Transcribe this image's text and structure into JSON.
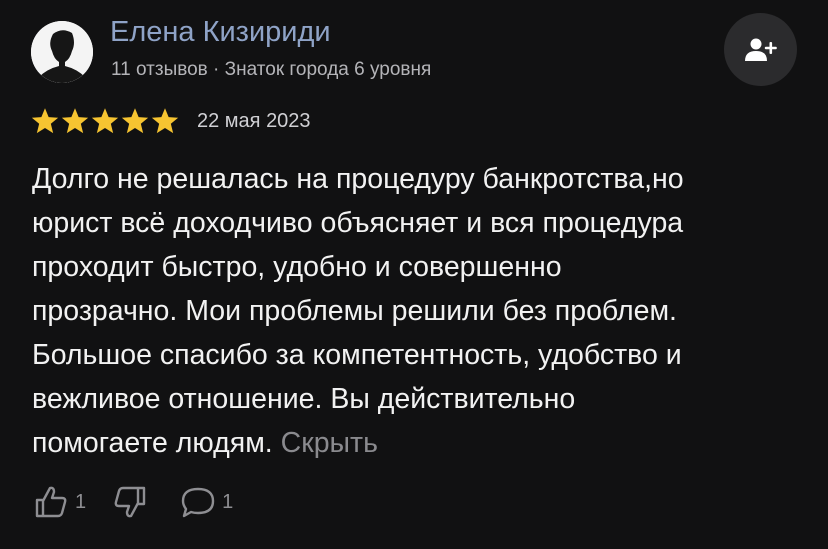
{
  "author": {
    "name": "Елена Кизириди",
    "meta": "11 отзывов · Знаток города 6 уровня"
  },
  "review": {
    "rating": 5,
    "rating_max": 5,
    "date": "22 мая 2023",
    "text_lines": [
      "Долго не решалась на процедуру банкротства,но",
      "юрист всё доходчиво объясняет и вся процедура",
      "проходит быстро, удобно и совершенно",
      "прозрачно. Мои проблемы решили без проблем.",
      "Большое спасибо за компетентность, удобство и",
      "вежливое отношение. Вы действительно",
      "помогаете людям."
    ],
    "collapse_label": "Скрыть"
  },
  "actions": {
    "likes": "1",
    "comments": "1"
  },
  "icons": {
    "avatar": "user-silhouette",
    "subscribe": "add-user-icon",
    "star": "star-icon",
    "like": "thumbs-up-icon",
    "dislike": "thumbs-down-icon",
    "comment": "comment-icon"
  },
  "colors": {
    "background": "#111112",
    "author_name": "#8fa3c7",
    "star": "#f6c431",
    "muted": "#8a8a8e"
  }
}
